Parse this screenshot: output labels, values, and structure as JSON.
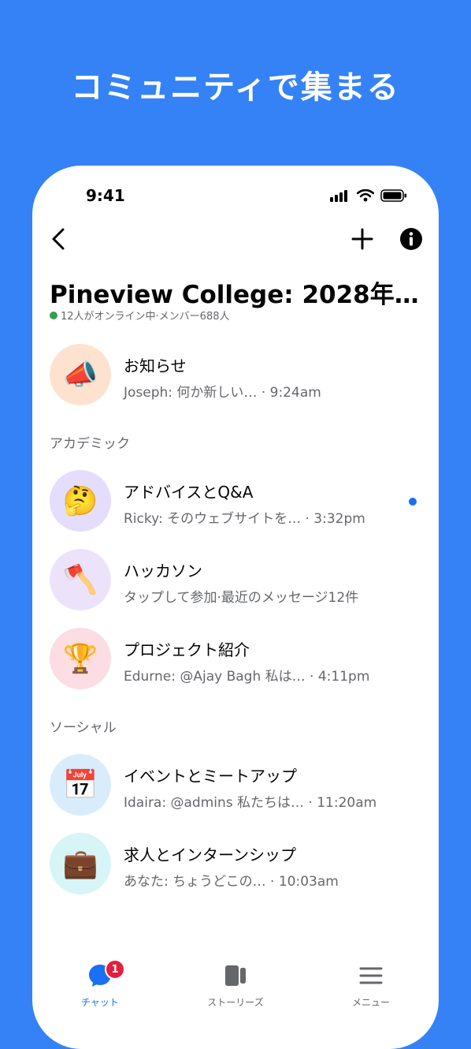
{
  "headline": "コミュニティで集まる",
  "status_bar": {
    "time": "9:41"
  },
  "nav": {
    "back_icon": "chevron-left-icon",
    "add_icon": "plus-icon",
    "info_icon": "info-icon"
  },
  "community": {
    "title": "Pineview College: 2028年…",
    "subtitle": "12人がオンライン中·メンバー688人"
  },
  "sections": [
    {
      "label": ""
    },
    {
      "label": "アカデミック"
    },
    {
      "label": "ソーシャル"
    }
  ],
  "chats": [
    {
      "emoji": "📣",
      "title": "お知らせ",
      "subtitle": "Joseph: 何か新しい… · 9:24am",
      "bg": "#fde3cf"
    },
    {
      "emoji": "🤔",
      "title": "アドバイスとQ&A",
      "subtitle": "Ricky: そのウェブサイトを… · 3:32pm",
      "bg": "#e4ddfb",
      "unread": true
    },
    {
      "emoji": "🪓",
      "title": "ハッカソン",
      "subtitle": "タップして参加·最近のメッセージ12件",
      "bg": "#ece3fb"
    },
    {
      "emoji": "🏆",
      "title": "プロジェクト紹介",
      "subtitle": "Edurne: @Ajay Bagh 私は… · 4:11pm",
      "bg": "#fbdde3"
    },
    {
      "emoji": "📅",
      "title": "イベントとミートアップ",
      "subtitle": "Idaira: @admins 私たちは… · 11:20am",
      "bg": "#d9ecfb"
    },
    {
      "emoji": "💼",
      "title": "求人とインターンシップ",
      "subtitle": "あなた: ちょうどこの… · 10:03am",
      "bg": "#d7f4f7"
    }
  ],
  "tabbar": {
    "tabs": [
      {
        "label": "チャット",
        "icon": "chat-bubble-icon",
        "badge": "1",
        "color": "#1b6ff5"
      },
      {
        "label": "ストーリーズ",
        "icon": "stories-icon",
        "color": "#65676b"
      },
      {
        "label": "メニュー",
        "icon": "menu-icon",
        "color": "#65676b"
      }
    ]
  },
  "colors": {
    "background": "#3582f6",
    "accent": "#1b6ff5",
    "online": "#31a24c",
    "badge": "#e41e3f"
  }
}
